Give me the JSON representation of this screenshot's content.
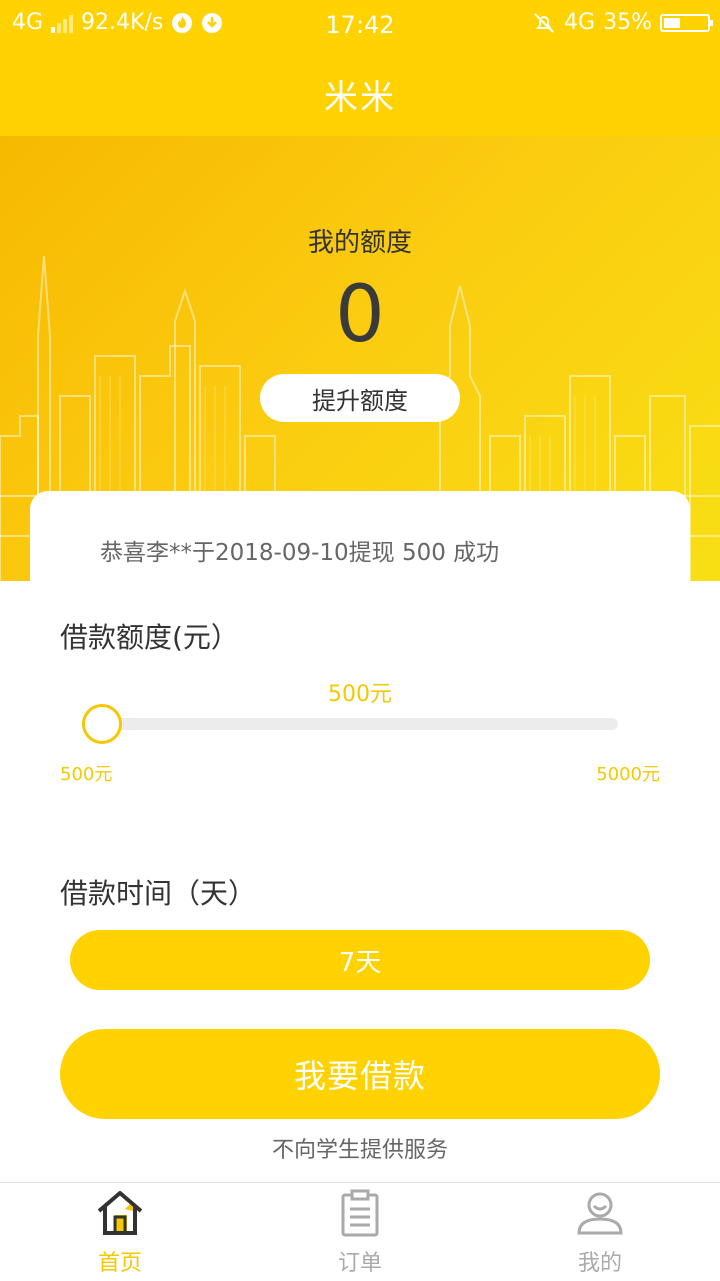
{
  "status_bar": {
    "network": "4G",
    "speed": "92.4K/s",
    "time": "17:42",
    "network_right": "4G",
    "battery": "35%"
  },
  "header": {
    "title": "米米"
  },
  "hero": {
    "quota_label": "我的额度",
    "quota_value": "0",
    "raise_button": "提升额度"
  },
  "notice": {
    "text": "恭喜李**于2018-09-10提现 500 成功"
  },
  "loan_amount": {
    "label": "借款额度(元）",
    "current": "500元",
    "min": "500元",
    "max": "5000元",
    "fraction": 0
  },
  "loan_term": {
    "label": "借款时间（天）",
    "value": "7天"
  },
  "actions": {
    "borrow_button": "我要借款",
    "disclaimer": "不向学生提供服务"
  },
  "nav": {
    "items": [
      {
        "label": "首页",
        "icon": "home-icon",
        "active": true
      },
      {
        "label": "订单",
        "icon": "order-icon",
        "active": false
      },
      {
        "label": "我的",
        "icon": "profile-icon",
        "active": false
      }
    ]
  },
  "colors": {
    "accent": "#ffd200",
    "accent_text": "#f5c800",
    "inactive": "#aaaaaa"
  }
}
